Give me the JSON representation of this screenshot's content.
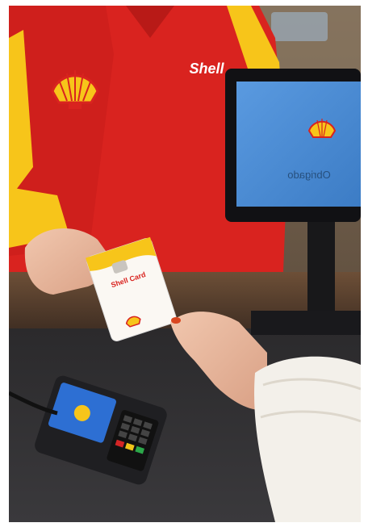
{
  "photo": {
    "monitor_text": "Obrigado",
    "card_text": "Shell Card",
    "shirt_text": "Shell",
    "colors": {
      "shirt_red": "#d9231f",
      "shell_yellow": "#f7c51a",
      "monitor_blue": "#4b8fd6",
      "counter": "#5b4433",
      "terminal": "#1f1f22",
      "sweater": "#f3f0ea"
    }
  }
}
